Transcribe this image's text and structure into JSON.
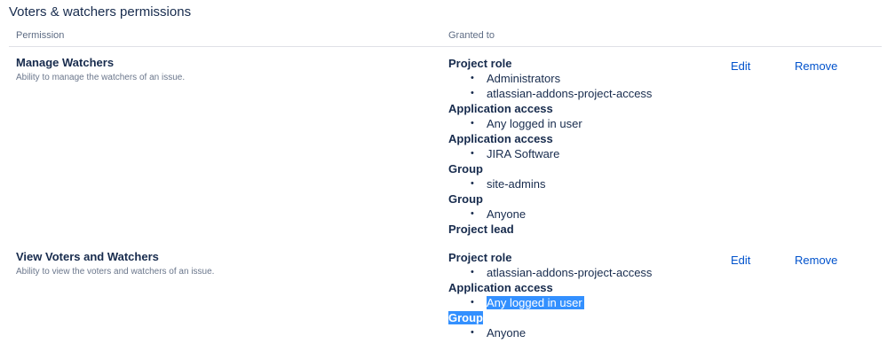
{
  "section": {
    "title": "Voters & watchers permissions"
  },
  "table": {
    "headers": {
      "permission": "Permission",
      "granted_to": "Granted to"
    },
    "actions": {
      "edit": "Edit",
      "remove": "Remove"
    }
  },
  "permissions": [
    {
      "name": "Manage Watchers",
      "description": "Ability to manage the watchers of an issue.",
      "grants": [
        {
          "type": "Project role",
          "items": [
            "Administrators",
            "atlassian-addons-project-access"
          ]
        },
        {
          "type": "Application access",
          "items": [
            "Any logged in user"
          ]
        },
        {
          "type": "Application access",
          "items": [
            "JIRA Software"
          ]
        },
        {
          "type": "Group",
          "items": [
            "site-admins"
          ]
        },
        {
          "type": "Group",
          "items": [
            "Anyone"
          ]
        },
        {
          "type": "Project lead",
          "items": []
        }
      ]
    },
    {
      "name": "View Voters and Watchers",
      "description": "Ability to view the voters and watchers of an issue.",
      "grants": [
        {
          "type": "Project role",
          "items": [
            "atlassian-addons-project-access"
          ]
        },
        {
          "type": "Application access",
          "items": [
            "Any logged in user"
          ]
        },
        {
          "type": "Group",
          "items": [
            "Anyone"
          ]
        }
      ]
    }
  ],
  "selection_highlight_color": "#3390ff"
}
